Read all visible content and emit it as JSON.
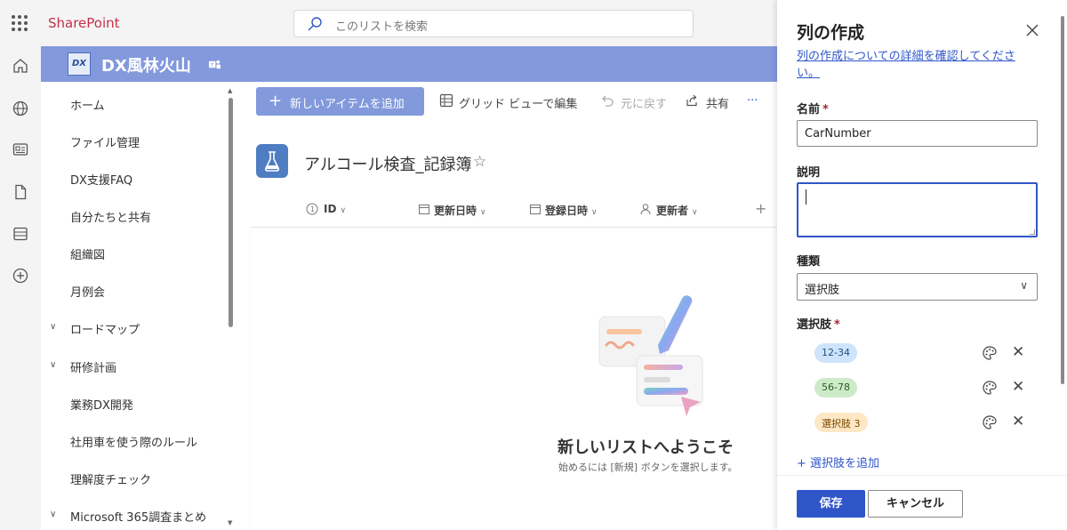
{
  "app": {
    "brand": "SharePoint",
    "search_placeholder": "このリストを検索"
  },
  "site": {
    "logo_text": "DX",
    "title": "DX風林火山"
  },
  "nav": {
    "items": [
      {
        "label": "ホーム",
        "expandable": false
      },
      {
        "label": "ファイル管理",
        "expandable": false
      },
      {
        "label": "DX支援FAQ",
        "expandable": false
      },
      {
        "label": "自分たちと共有",
        "expandable": false
      },
      {
        "label": "組織図",
        "expandable": false
      },
      {
        "label": "月例会",
        "expandable": false
      },
      {
        "label": "ロードマップ",
        "expandable": true
      },
      {
        "label": "研修計画",
        "expandable": true
      },
      {
        "label": "業務DX開発",
        "expandable": false
      },
      {
        "label": "社用車を使う際のルール",
        "expandable": false
      },
      {
        "label": "理解度チェック",
        "expandable": false
      },
      {
        "label": "Microsoft 365調査まとめ",
        "expandable": true
      }
    ]
  },
  "toolbar": {
    "new_item": "新しいアイテムを追加",
    "grid_edit": "グリッド ビューで編集",
    "undo": "元に戻す",
    "share": "共有",
    "more": "···"
  },
  "list": {
    "title": "アルコール検査_記録簿",
    "columns": [
      {
        "label": "ID"
      },
      {
        "label": "更新日時"
      },
      {
        "label": "登録日時"
      },
      {
        "label": "更新者"
      }
    ],
    "empty_title": "新しいリストへようこそ",
    "empty_sub": "始めるには [新規] ボタンを選択します。"
  },
  "panel": {
    "title": "列の作成",
    "learn_more": "列の作成についての詳細を確認してください。",
    "name_label": "名前",
    "name_value": "CarNumber",
    "desc_label": "説明",
    "desc_value": "",
    "type_label": "種類",
    "type_value": "選択肢",
    "choices_label": "選択肢",
    "required_mark": "*",
    "choices": [
      {
        "label": "12-34",
        "bg": "#cfe4fa",
        "fg": "#1b4f8a"
      },
      {
        "label": "56-78",
        "bg": "#cdebc9",
        "fg": "#2b5e23"
      },
      {
        "label": "選択肢 3",
        "bg": "#fde7c4",
        "fg": "#7a4a00"
      }
    ],
    "add_choice": "選択肢を追加",
    "save": "保存",
    "cancel": "キャンセル"
  },
  "colors": {
    "accent": "#8299dc",
    "primary": "#2f56c9",
    "brand_red": "#c4314b"
  }
}
